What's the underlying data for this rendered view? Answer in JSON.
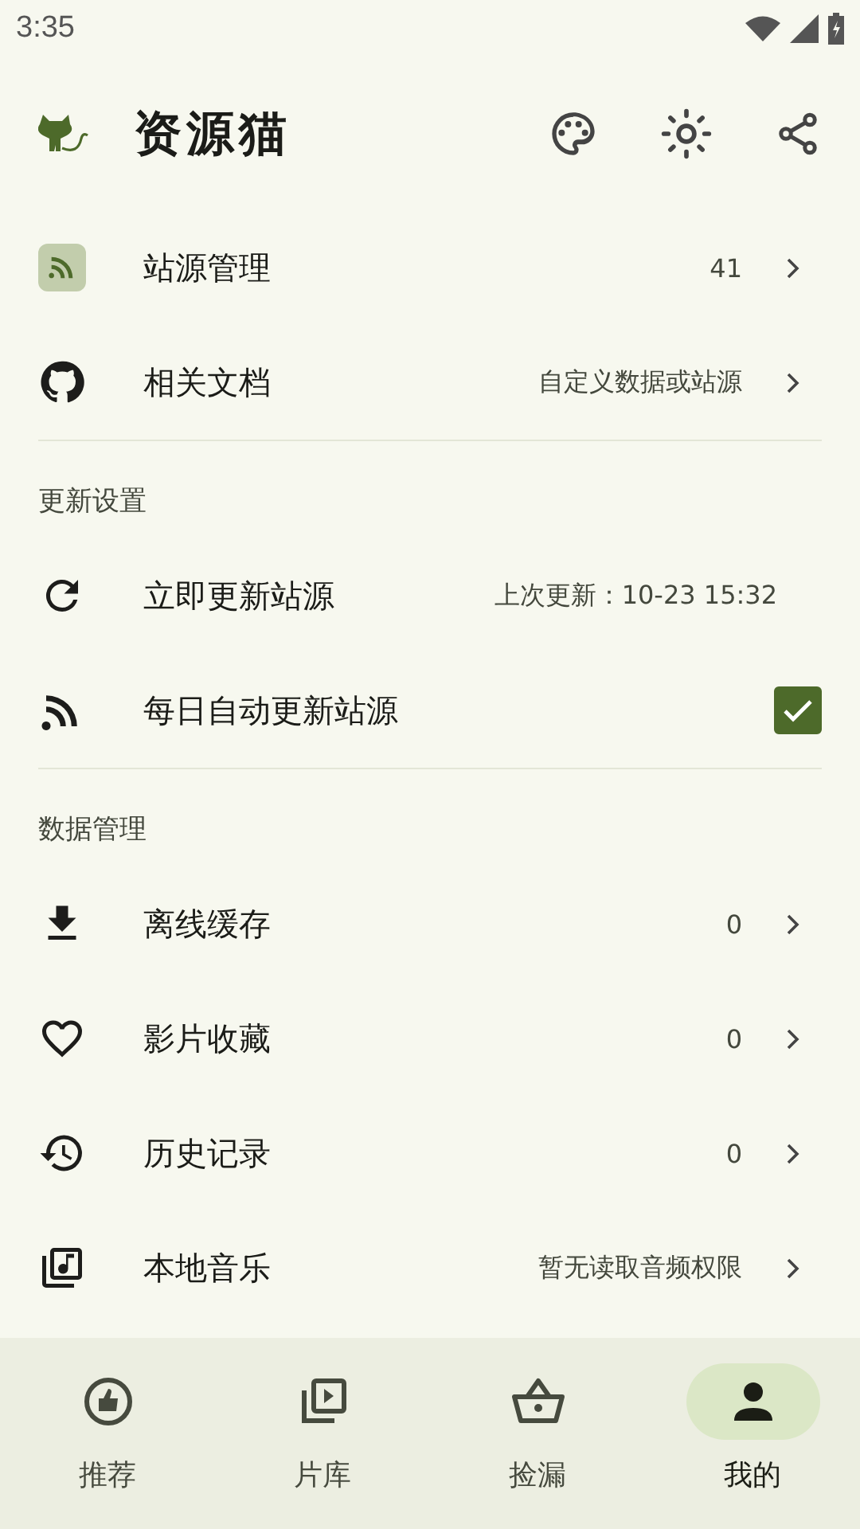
{
  "status_bar": {
    "time": "3:35"
  },
  "app_bar": {
    "title": "资源猫"
  },
  "sections": [
    {
      "items": [
        {
          "kind": "link",
          "label": "站源管理",
          "value": "41"
        },
        {
          "kind": "link",
          "label": "相关文档",
          "value": "自定义数据或站源"
        }
      ]
    },
    {
      "header": "更新设置",
      "items": [
        {
          "kind": "action",
          "label": "立即更新站源",
          "value": "上次更新：10-23 15:32"
        },
        {
          "kind": "checkbox",
          "label": "每日自动更新站源",
          "checked": true
        }
      ]
    },
    {
      "header": "数据管理",
      "items": [
        {
          "kind": "link",
          "label": "离线缓存",
          "value": "0"
        },
        {
          "kind": "link",
          "label": "影片收藏",
          "value": "0"
        },
        {
          "kind": "link",
          "label": "历史记录",
          "value": "0"
        },
        {
          "kind": "link",
          "label": "本地音乐",
          "value": "暂无读取音频权限"
        }
      ]
    }
  ],
  "bottom_nav": [
    {
      "label": "推荐",
      "selected": false
    },
    {
      "label": "片库",
      "selected": false
    },
    {
      "label": "捡漏",
      "selected": false
    },
    {
      "label": "我的",
      "selected": true
    }
  ]
}
